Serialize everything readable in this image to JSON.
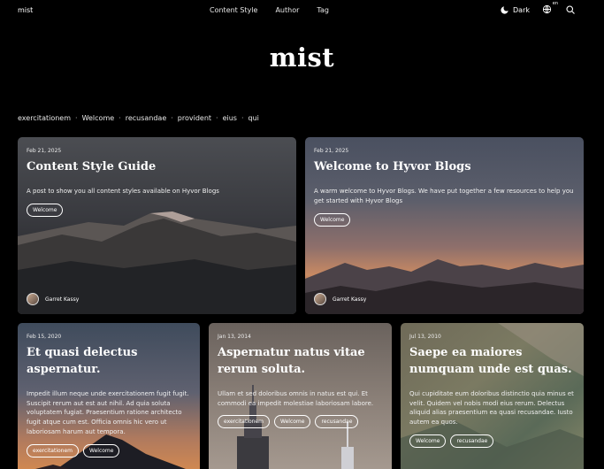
{
  "header": {
    "brand": "mist",
    "nav": [
      "Content Style",
      "Author",
      "Tag"
    ],
    "theme_label": "Dark",
    "lang_badge": "en"
  },
  "site_title": "mist",
  "tags": [
    "exercitationem",
    "Welcome",
    "recusandae",
    "provident",
    "eius",
    "qui"
  ],
  "cards": [
    {
      "date": "Feb 21, 2025",
      "title": "Content Style Guide",
      "excerpt": "A post to show you all content styles available on Hyvor Blogs",
      "tags": [
        "Welcome"
      ],
      "author": "Garret Kassy"
    },
    {
      "date": "Feb 21, 2025",
      "title": "Welcome to Hyvor Blogs",
      "excerpt": "A warm welcome to Hyvor Blogs. We have put together a few resources to help you get started with Hyvor Blogs",
      "tags": [
        "Welcome"
      ],
      "author": "Garret Kassy"
    },
    {
      "date": "Feb 15, 2020",
      "title": "Et quasi delectus aspernatur.",
      "excerpt": "Impedit illum neque unde exercitationem fugit fugit. Suscipit rerum aut est aut nihil. Ad quia soluta voluptatem fugiat. Praesentium ratione architecto fugit atque cum est. Officia omnis hic vero ut laboriosam harum aut tempora.",
      "tags": [
        "exercitationem",
        "Welcome"
      ]
    },
    {
      "date": "Jan 13, 2014",
      "title": "Aspernatur natus vitae rerum soluta.",
      "excerpt": "Ullam et sed doloribus omnis in natus est qui. Et commodi ea impedit molestiae laboriosam labore.",
      "tags": [
        "exercitationem",
        "Welcome",
        "recusandae"
      ]
    },
    {
      "date": "Jul 13, 2010",
      "title": "Saepe ea maiores numquam unde est quas.",
      "excerpt": "Qui cupiditate eum doloribus distinctio quia minus et velit. Quidem vel nobis modi eius rerum. Delectus aliquid alias praesentium ea quasi recusandae. Iusto autem ea quos.",
      "tags": [
        "Welcome",
        "recusandae"
      ]
    }
  ]
}
